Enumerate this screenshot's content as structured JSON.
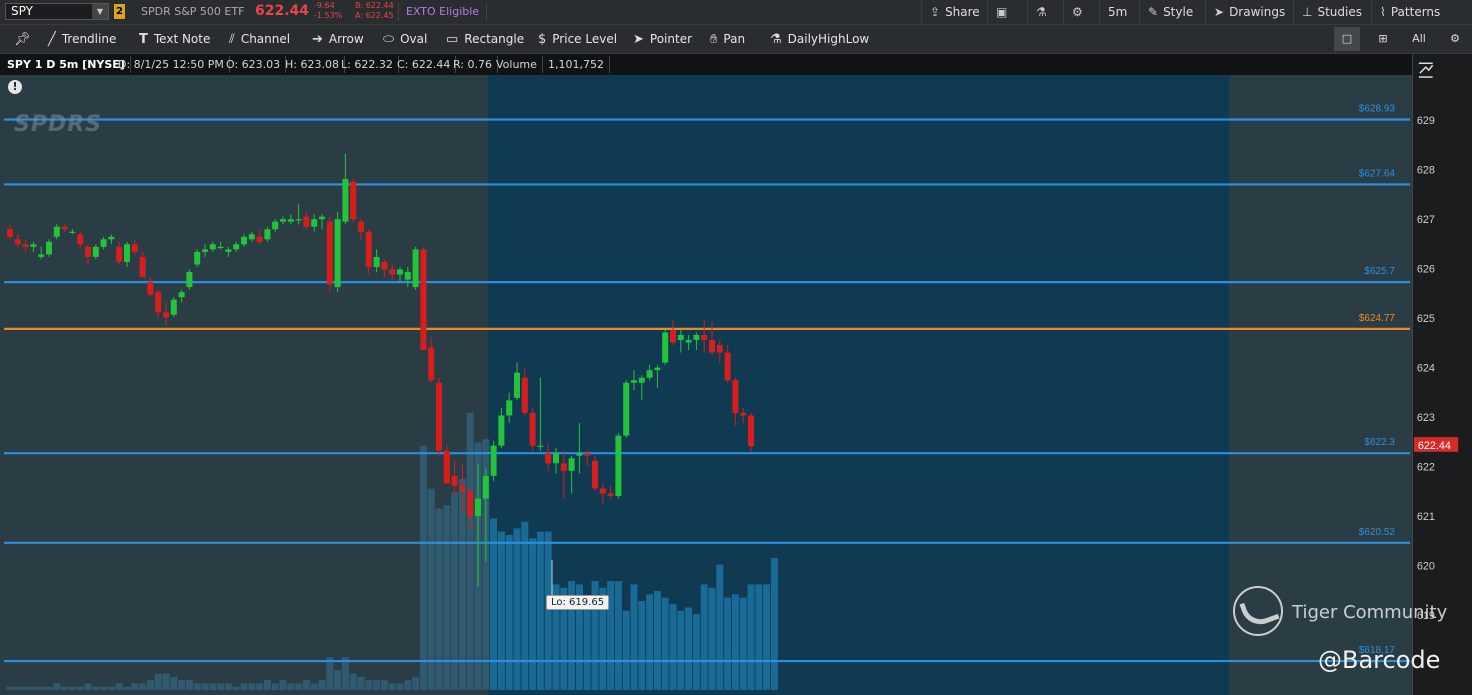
{
  "header": {
    "symbol": "SPY",
    "link_badge": "2",
    "company": "SPDR S&P 500 ETF",
    "last": "622.44",
    "change_abs": "-9.64",
    "change_pct": "-1.53%",
    "bid": "B: 622.44",
    "ask": "A: 622.45",
    "exto": "EXTO Eligible",
    "buttons": {
      "share": "Share",
      "interval": "5m",
      "style": "Style",
      "drawings": "Drawings",
      "studies": "Studies",
      "patterns": "Patterns"
    }
  },
  "toolbar": {
    "tools": [
      "Trendline",
      "Text Note",
      "Channel",
      "Arrow",
      "Oval",
      "Rectangle",
      "Price Level",
      "Pointer",
      "Pan",
      "DailyHighLow"
    ],
    "all_label": "All"
  },
  "infobar": {
    "symbol": "SPY 1 D 5m [NYSE]",
    "date": "D: 8/1/25 12:50 PM",
    "open": "O: 623.03",
    "high": "H: 623.08",
    "low": "L: 622.32",
    "close": "C: 622.44",
    "range": "R: 0.76",
    "volume_label": "Volume",
    "volume": "1,101,752"
  },
  "colors": {
    "up": "#23c43a",
    "down": "#d91d1d",
    "level": "#2d8ee0",
    "orange": "#e8892b",
    "highlight": "#0f3a52",
    "price_tag": "#d42a2a"
  },
  "chart_data": {
    "type": "candlestick",
    "y_ticks": [
      629,
      628,
      627,
      626,
      625,
      624,
      623,
      622,
      621,
      620,
      619
    ],
    "ylim": [
      618.5,
      629.3
    ],
    "price_levels": [
      {
        "label": "$628.93",
        "value": 628.93,
        "color": "#2d8ee0"
      },
      {
        "label": "$627.64",
        "value": 627.64,
        "color": "#2d8ee0"
      },
      {
        "label": "$625.7",
        "value": 625.7,
        "color": "#2d8ee0"
      },
      {
        "label": "$624.77",
        "value": 624.77,
        "color": "#e8892b"
      },
      {
        "label": "$622.3",
        "value": 622.3,
        "color": "#2d8ee0"
      },
      {
        "label": "$620.52",
        "value": 620.52,
        "color": "#2d8ee0"
      },
      {
        "label": "$618.17",
        "value": 618.17,
        "color": "#2d8ee0"
      }
    ],
    "current_price": {
      "label": "622.44",
      "value": 622.44
    },
    "low_label": "Lo: 619.65",
    "low_value": 619.65,
    "candles": [
      [
        626.75,
        626.85,
        626.55,
        626.6
      ],
      [
        626.55,
        626.65,
        626.35,
        626.45
      ],
      [
        626.45,
        626.55,
        626.3,
        626.4
      ],
      [
        626.4,
        626.5,
        626.3,
        626.45
      ],
      [
        626.2,
        626.4,
        626.15,
        626.25
      ],
      [
        626.25,
        626.55,
        626.2,
        626.5
      ],
      [
        626.6,
        626.85,
        626.55,
        626.8
      ],
      [
        626.8,
        626.85,
        626.7,
        626.75
      ],
      [
        626.7,
        626.75,
        626.65,
        626.7
      ],
      [
        626.65,
        626.7,
        626.35,
        626.45
      ],
      [
        626.4,
        626.45,
        626.05,
        626.2
      ],
      [
        626.2,
        626.45,
        626.15,
        626.4
      ],
      [
        626.4,
        626.6,
        626.35,
        626.55
      ],
      [
        626.55,
        626.65,
        626.45,
        626.6
      ],
      [
        626.4,
        626.5,
        626.05,
        626.1
      ],
      [
        626.1,
        626.5,
        626.0,
        626.45
      ],
      [
        626.45,
        626.55,
        626.25,
        626.3
      ],
      [
        626.2,
        626.3,
        625.8,
        625.8
      ],
      [
        625.7,
        625.8,
        625.4,
        625.45
      ],
      [
        625.5,
        625.55,
        625.0,
        625.1
      ],
      [
        625.1,
        625.3,
        624.85,
        625.0
      ],
      [
        625.05,
        625.4,
        625.0,
        625.35
      ],
      [
        625.4,
        625.55,
        625.3,
        625.5
      ],
      [
        625.6,
        625.95,
        625.55,
        625.9
      ],
      [
        626.05,
        626.35,
        626.0,
        626.3
      ],
      [
        626.3,
        626.45,
        626.2,
        626.35
      ],
      [
        626.35,
        626.5,
        626.3,
        626.45
      ],
      [
        626.4,
        626.5,
        626.35,
        626.4
      ],
      [
        626.3,
        626.4,
        626.2,
        626.35
      ],
      [
        626.35,
        626.5,
        626.3,
        626.45
      ],
      [
        626.45,
        626.65,
        626.4,
        626.6
      ],
      [
        626.55,
        626.7,
        626.5,
        626.65
      ],
      [
        626.6,
        626.75,
        626.45,
        626.5
      ],
      [
        626.55,
        626.8,
        626.5,
        626.75
      ],
      [
        626.75,
        626.95,
        626.7,
        626.9
      ],
      [
        626.9,
        627.0,
        626.85,
        626.95
      ],
      [
        626.9,
        627.05,
        626.85,
        626.95
      ],
      [
        626.95,
        627.25,
        626.85,
        626.95
      ],
      [
        627.0,
        627.1,
        626.75,
        626.8
      ],
      [
        626.8,
        627.05,
        626.7,
        626.95
      ],
      [
        626.95,
        627.05,
        626.75,
        627.0
      ],
      [
        626.9,
        627.0,
        625.5,
        625.65
      ],
      [
        625.6,
        627.1,
        625.5,
        626.95
      ],
      [
        626.9,
        628.25,
        626.85,
        627.75
      ],
      [
        627.7,
        627.75,
        626.9,
        626.95
      ],
      [
        626.9,
        626.95,
        626.55,
        626.7
      ],
      [
        626.7,
        626.75,
        625.85,
        626.0
      ],
      [
        626.0,
        626.35,
        625.9,
        626.2
      ],
      [
        626.1,
        626.15,
        625.8,
        625.95
      ],
      [
        625.95,
        626.05,
        625.75,
        625.85
      ],
      [
        625.85,
        626.0,
        625.7,
        625.95
      ],
      [
        625.75,
        626.0,
        625.6,
        625.9
      ],
      [
        625.6,
        626.4,
        625.55,
        626.35
      ],
      [
        626.35,
        626.4,
        624.35,
        624.35
      ],
      [
        624.4,
        624.6,
        623.7,
        623.75
      ],
      [
        623.7,
        623.8,
        622.25,
        622.35
      ],
      [
        622.35,
        622.45,
        621.7,
        621.7
      ],
      [
        621.85,
        622.15,
        621.45,
        621.65
      ],
      [
        621.65,
        622.1,
        621.1,
        621.55
      ],
      [
        621.55,
        621.6,
        620.8,
        621.05
      ],
      [
        621.05,
        622.1,
        619.65,
        621.4
      ],
      [
        621.4,
        622.0,
        620.15,
        621.85
      ],
      [
        621.85,
        622.55,
        621.75,
        622.45
      ],
      [
        622.45,
        623.2,
        622.4,
        623.05
      ],
      [
        623.05,
        623.5,
        622.9,
        623.35
      ],
      [
        623.4,
        624.1,
        623.35,
        623.9
      ],
      [
        623.8,
        624.0,
        623.05,
        623.1
      ],
      [
        623.1,
        623.2,
        622.35,
        622.45
      ],
      [
        622.45,
        623.8,
        622.35,
        622.45
      ],
      [
        622.3,
        622.5,
        621.95,
        622.1
      ],
      [
        622.1,
        622.4,
        621.9,
        622.3
      ],
      [
        622.1,
        622.35,
        621.4,
        621.95
      ],
      [
        621.95,
        622.25,
        621.5,
        622.2
      ],
      [
        622.25,
        622.9,
        621.9,
        622.3
      ],
      [
        622.3,
        622.35,
        622.05,
        622.25
      ],
      [
        622.15,
        622.25,
        621.55,
        621.6
      ],
      [
        621.6,
        621.7,
        621.3,
        621.5
      ],
      [
        621.5,
        621.65,
        621.4,
        621.45
      ],
      [
        621.45,
        622.7,
        621.4,
        622.65
      ],
      [
        622.65,
        623.75,
        622.6,
        623.7
      ],
      [
        623.7,
        623.95,
        623.55,
        623.75
      ],
      [
        623.7,
        623.85,
        623.35,
        623.8
      ],
      [
        623.8,
        624.05,
        623.75,
        623.95
      ],
      [
        623.95,
        624.05,
        623.6,
        624.0
      ],
      [
        624.1,
        624.75,
        624.05,
        624.7
      ],
      [
        624.75,
        624.95,
        624.45,
        624.5
      ],
      [
        624.55,
        624.75,
        624.3,
        624.65
      ],
      [
        624.5,
        624.65,
        624.35,
        624.55
      ],
      [
        624.55,
        624.7,
        624.35,
        624.65
      ],
      [
        624.65,
        624.95,
        624.3,
        624.55
      ],
      [
        624.55,
        624.9,
        624.25,
        624.3
      ],
      [
        624.45,
        624.55,
        624.1,
        624.3
      ],
      [
        624.3,
        624.45,
        623.7,
        623.75
      ],
      [
        623.75,
        623.8,
        622.85,
        623.1
      ],
      [
        623.1,
        623.2,
        622.9,
        623.05
      ],
      [
        623.05,
        623.1,
        622.32,
        622.44
      ]
    ],
    "volume_rel": [
      0.01,
      0.01,
      0.01,
      0.01,
      0.01,
      0.01,
      0.02,
      0.01,
      0.01,
      0.01,
      0.02,
      0.01,
      0.01,
      0.01,
      0.02,
      0.01,
      0.02,
      0.02,
      0.03,
      0.05,
      0.05,
      0.04,
      0.03,
      0.03,
      0.02,
      0.02,
      0.02,
      0.02,
      0.02,
      0.01,
      0.02,
      0.02,
      0.02,
      0.03,
      0.02,
      0.03,
      0.02,
      0.02,
      0.03,
      0.02,
      0.03,
      0.1,
      0.06,
      0.1,
      0.05,
      0.04,
      0.03,
      0.03,
      0.03,
      0.02,
      0.02,
      0.03,
      0.04,
      0.74,
      0.61,
      0.55,
      0.56,
      0.6,
      0.64,
      0.84,
      0.75,
      0.76,
      0.52,
      0.48,
      0.47,
      0.49,
      0.51,
      0.46,
      0.48,
      0.48,
      0.32,
      0.31,
      0.33,
      0.32,
      0.28,
      0.33,
      0.31,
      0.33,
      0.33,
      0.24,
      0.32,
      0.27,
      0.29,
      0.3,
      0.28,
      0.26,
      0.24,
      0.25,
      0.23,
      0.32,
      0.31,
      0.38,
      0.28,
      0.29,
      0.28,
      0.32,
      0.32,
      0.32,
      0.4
    ]
  },
  "watermark": {
    "brand": "Tiger Community",
    "handle": "@Barcode",
    "logo_text": "SPDRS"
  }
}
